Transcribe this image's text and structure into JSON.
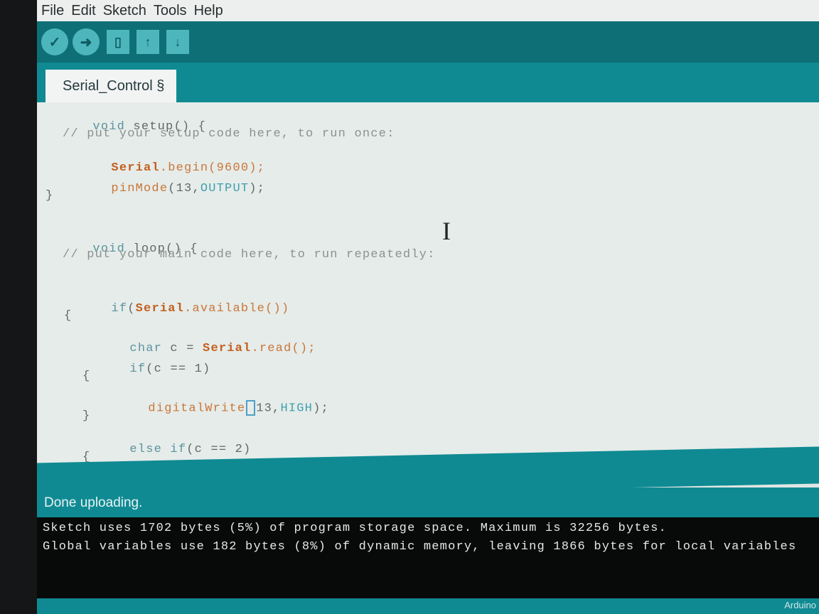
{
  "menu": [
    "File",
    "Edit",
    "Sketch",
    "Tools",
    "Help"
  ],
  "toolbar": {
    "verify_icon": "check-icon",
    "upload_icon": "arrow-right-icon",
    "new_icon": "file-icon",
    "open_icon": "arrow-up-icon",
    "save_icon": "arrow-down-icon"
  },
  "tab": {
    "label": "Serial_Control §"
  },
  "code": {
    "l1_kw": "void",
    "l1_rest": " setup() {",
    "l2": "// put your setup code here, to run once:",
    "l3_obj": "Serial",
    "l3_rest": ".begin(9600);",
    "l4_fn": "pinMode",
    "l4_args": "(13,",
    "l4_const": "OUTPUT",
    "l4_end": ");",
    "l5": "}",
    "l6_kw": "void",
    "l6_rest": " loop() {",
    "l7": "// put your main code here, to run repeatedly:",
    "l8_kw": "if",
    "l8_open": "(",
    "l8_obj": "Serial",
    "l8_rest": ".available())",
    "l9": "{",
    "l10_kw": "char",
    "l10_mid": " c = ",
    "l10_obj": "Serial",
    "l10_rest": ".read();",
    "l11_kw": "if",
    "l11_rest": "(c == 1)",
    "l12": "{",
    "l13_fn": "digitalWrite",
    "l13_args": "13,",
    "l13_const": "HIGH",
    "l13_end": ");",
    "l14": "}",
    "l15_kw": "else if",
    "l15_rest": "(c == 2)",
    "l16": "{"
  },
  "status": {
    "message": "Done uploading."
  },
  "console": [
    "Sketch uses 1702 bytes (5%) of program storage space. Maximum is 32256 bytes.",
    "Global variables use 182 bytes (8%) of dynamic memory, leaving 1866 bytes for local variables"
  ],
  "footer": {
    "label": "Arduino"
  }
}
